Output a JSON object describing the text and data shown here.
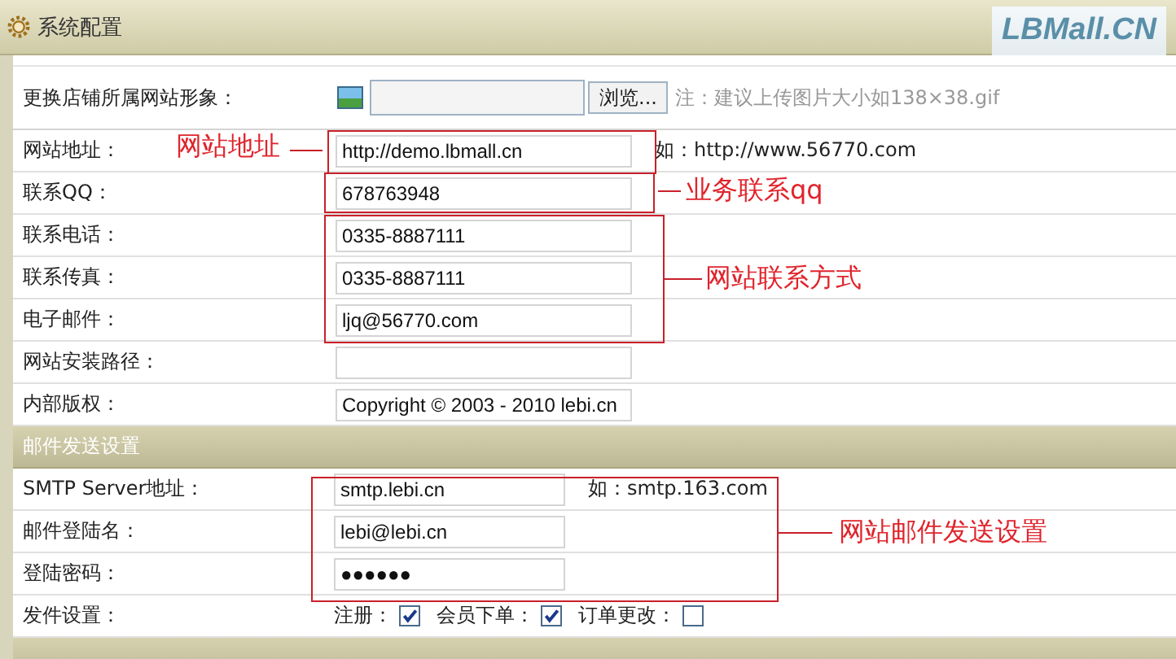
{
  "window": {
    "title": "系统配置"
  },
  "logo": {
    "text": "LBMall.CN"
  },
  "sections": [
    {
      "rows": [
        {
          "kind": "file",
          "label": "更换店铺所属网站形象：",
          "button": "浏览...",
          "hint": "注：建议上传图片大小如138×38.gif"
        },
        {
          "kind": "text",
          "label": "网站地址：",
          "value": "http://demo.lbmall.cn",
          "hint": "如：http://www.56770.com"
        },
        {
          "kind": "text",
          "label": "联系QQ：",
          "value": "678763948"
        },
        {
          "kind": "text",
          "label": "联系电话：",
          "value": "0335-8887111"
        },
        {
          "kind": "text",
          "label": "联系传真：",
          "value": "0335-8887111"
        },
        {
          "kind": "text",
          "label": "电子邮件：",
          "value": "ljq@56770.com"
        },
        {
          "kind": "text",
          "label": "网站安装路径："
        },
        {
          "kind": "text",
          "label": "内部版权：",
          "value": "Copyright ©  2003 - 2010 lebi.cn"
        }
      ]
    },
    {
      "title": "邮件发送设置",
      "rows": [
        {
          "kind": "text",
          "label": "SMTP Server地址：",
          "value": "smtp.lebi.cn",
          "hint": "如：smtp.163.com"
        },
        {
          "kind": "text",
          "label": "邮件登陆名：",
          "value": "lebi@lebi.cn"
        },
        {
          "kind": "text",
          "label": "登陆密码：",
          "value": "●●●●●●"
        },
        {
          "kind": "checks",
          "label": "发件设置：",
          "options": [
            {
              "label": "注册：",
              "checked": true
            },
            {
              "label": "会员下单：",
              "checked": true
            },
            {
              "label": "订单更改：",
              "checked": false
            }
          ]
        }
      ]
    }
  ],
  "annotations": [
    {
      "text": "网站地址"
    },
    {
      "text": "业务联系qq"
    },
    {
      "text": "网站联系方式"
    },
    {
      "text": "网站邮件发送设置"
    }
  ]
}
